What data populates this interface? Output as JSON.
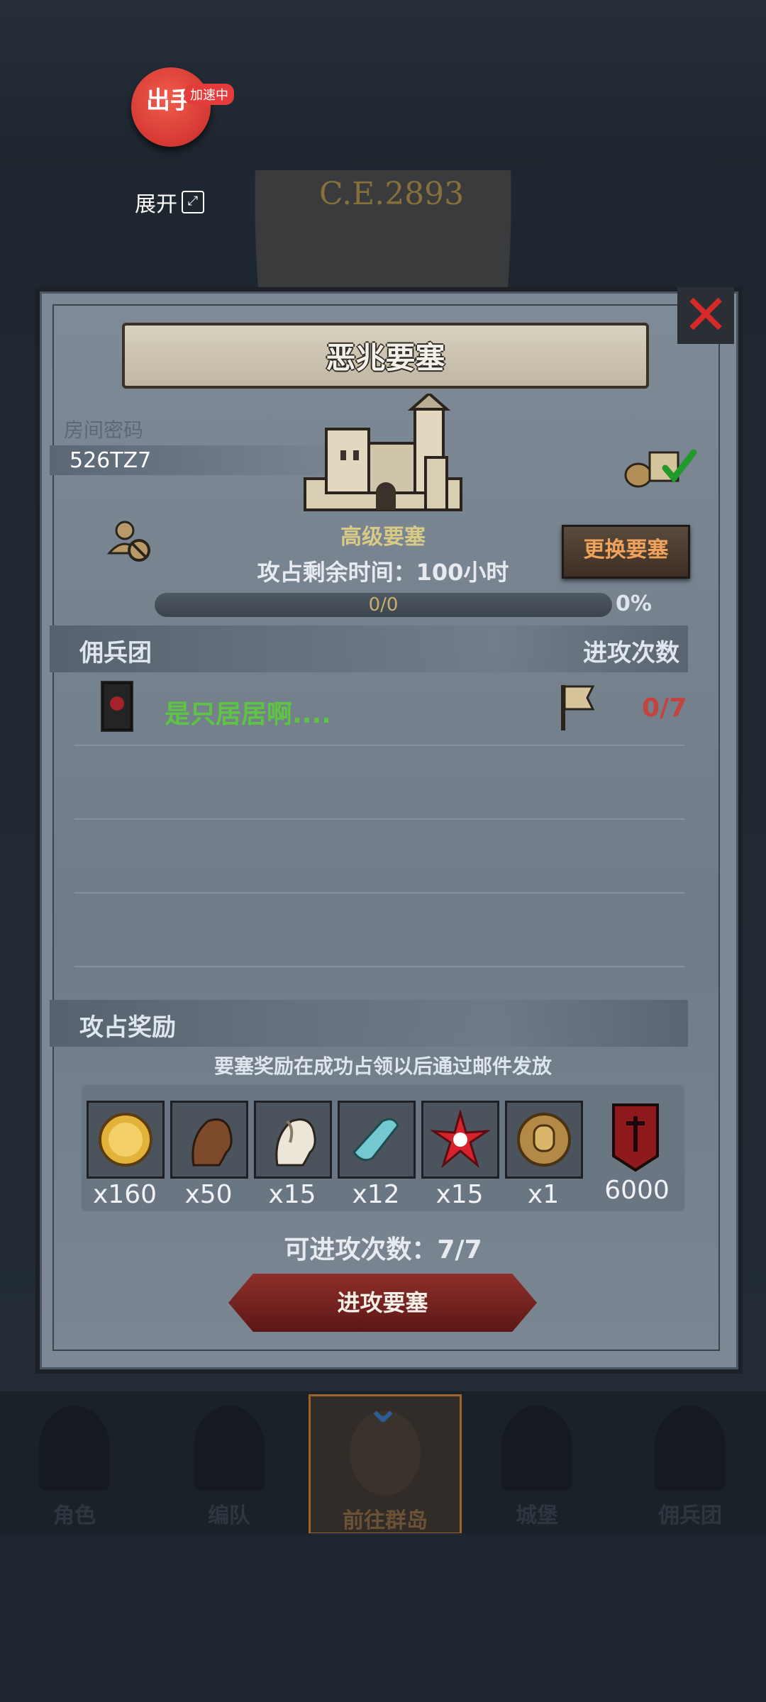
{
  "overlay": {
    "helper_label": "出手",
    "helper_badge": "加速中",
    "expand_label": "展开"
  },
  "background": {
    "era_text": "C.E.2893"
  },
  "panel": {
    "title": "恶兆要塞",
    "room_label": "房间密码",
    "room_code": "526TZ7",
    "fortress_type": "高级要塞",
    "change_button": "更换要塞",
    "time_remaining": "攻占剩余时间：100小时",
    "progress_text": "0/0",
    "progress_fraction": 0,
    "progress_percent": "0%",
    "mercenary_header": "佣兵团",
    "attacks_header": "进攻次数",
    "rows": [
      {
        "name": "是只居居啊....",
        "count": "0/7"
      }
    ],
    "rewards_header": "攻占奖励",
    "reward_note": "要塞奖励在成功占领以后通过邮件发放",
    "rewards": [
      {
        "icon": "gold-coin-icon",
        "qty": "x160"
      },
      {
        "icon": "brown-horse-icon",
        "qty": "x50"
      },
      {
        "icon": "white-horse-icon",
        "qty": "x15"
      },
      {
        "icon": "cloth-roll-icon",
        "qty": "x12"
      },
      {
        "icon": "red-star-icon",
        "qty": "x15"
      },
      {
        "icon": "knight-medal-icon",
        "qty": "x1"
      },
      {
        "icon": "red-banner-icon",
        "qty": "6000"
      }
    ],
    "attacks_left": "可进攻次数：7/7",
    "attack_button": "进攻要塞"
  },
  "nav": {
    "items": [
      "角色",
      "编队",
      "前往群岛",
      "城堡",
      "佣兵团"
    ],
    "active_index": 2
  },
  "colors": {
    "accent_green": "#5ec443",
    "accent_red": "#c5433f",
    "button_red": "#8e2f2b",
    "gold_text": "#d9ca86"
  }
}
